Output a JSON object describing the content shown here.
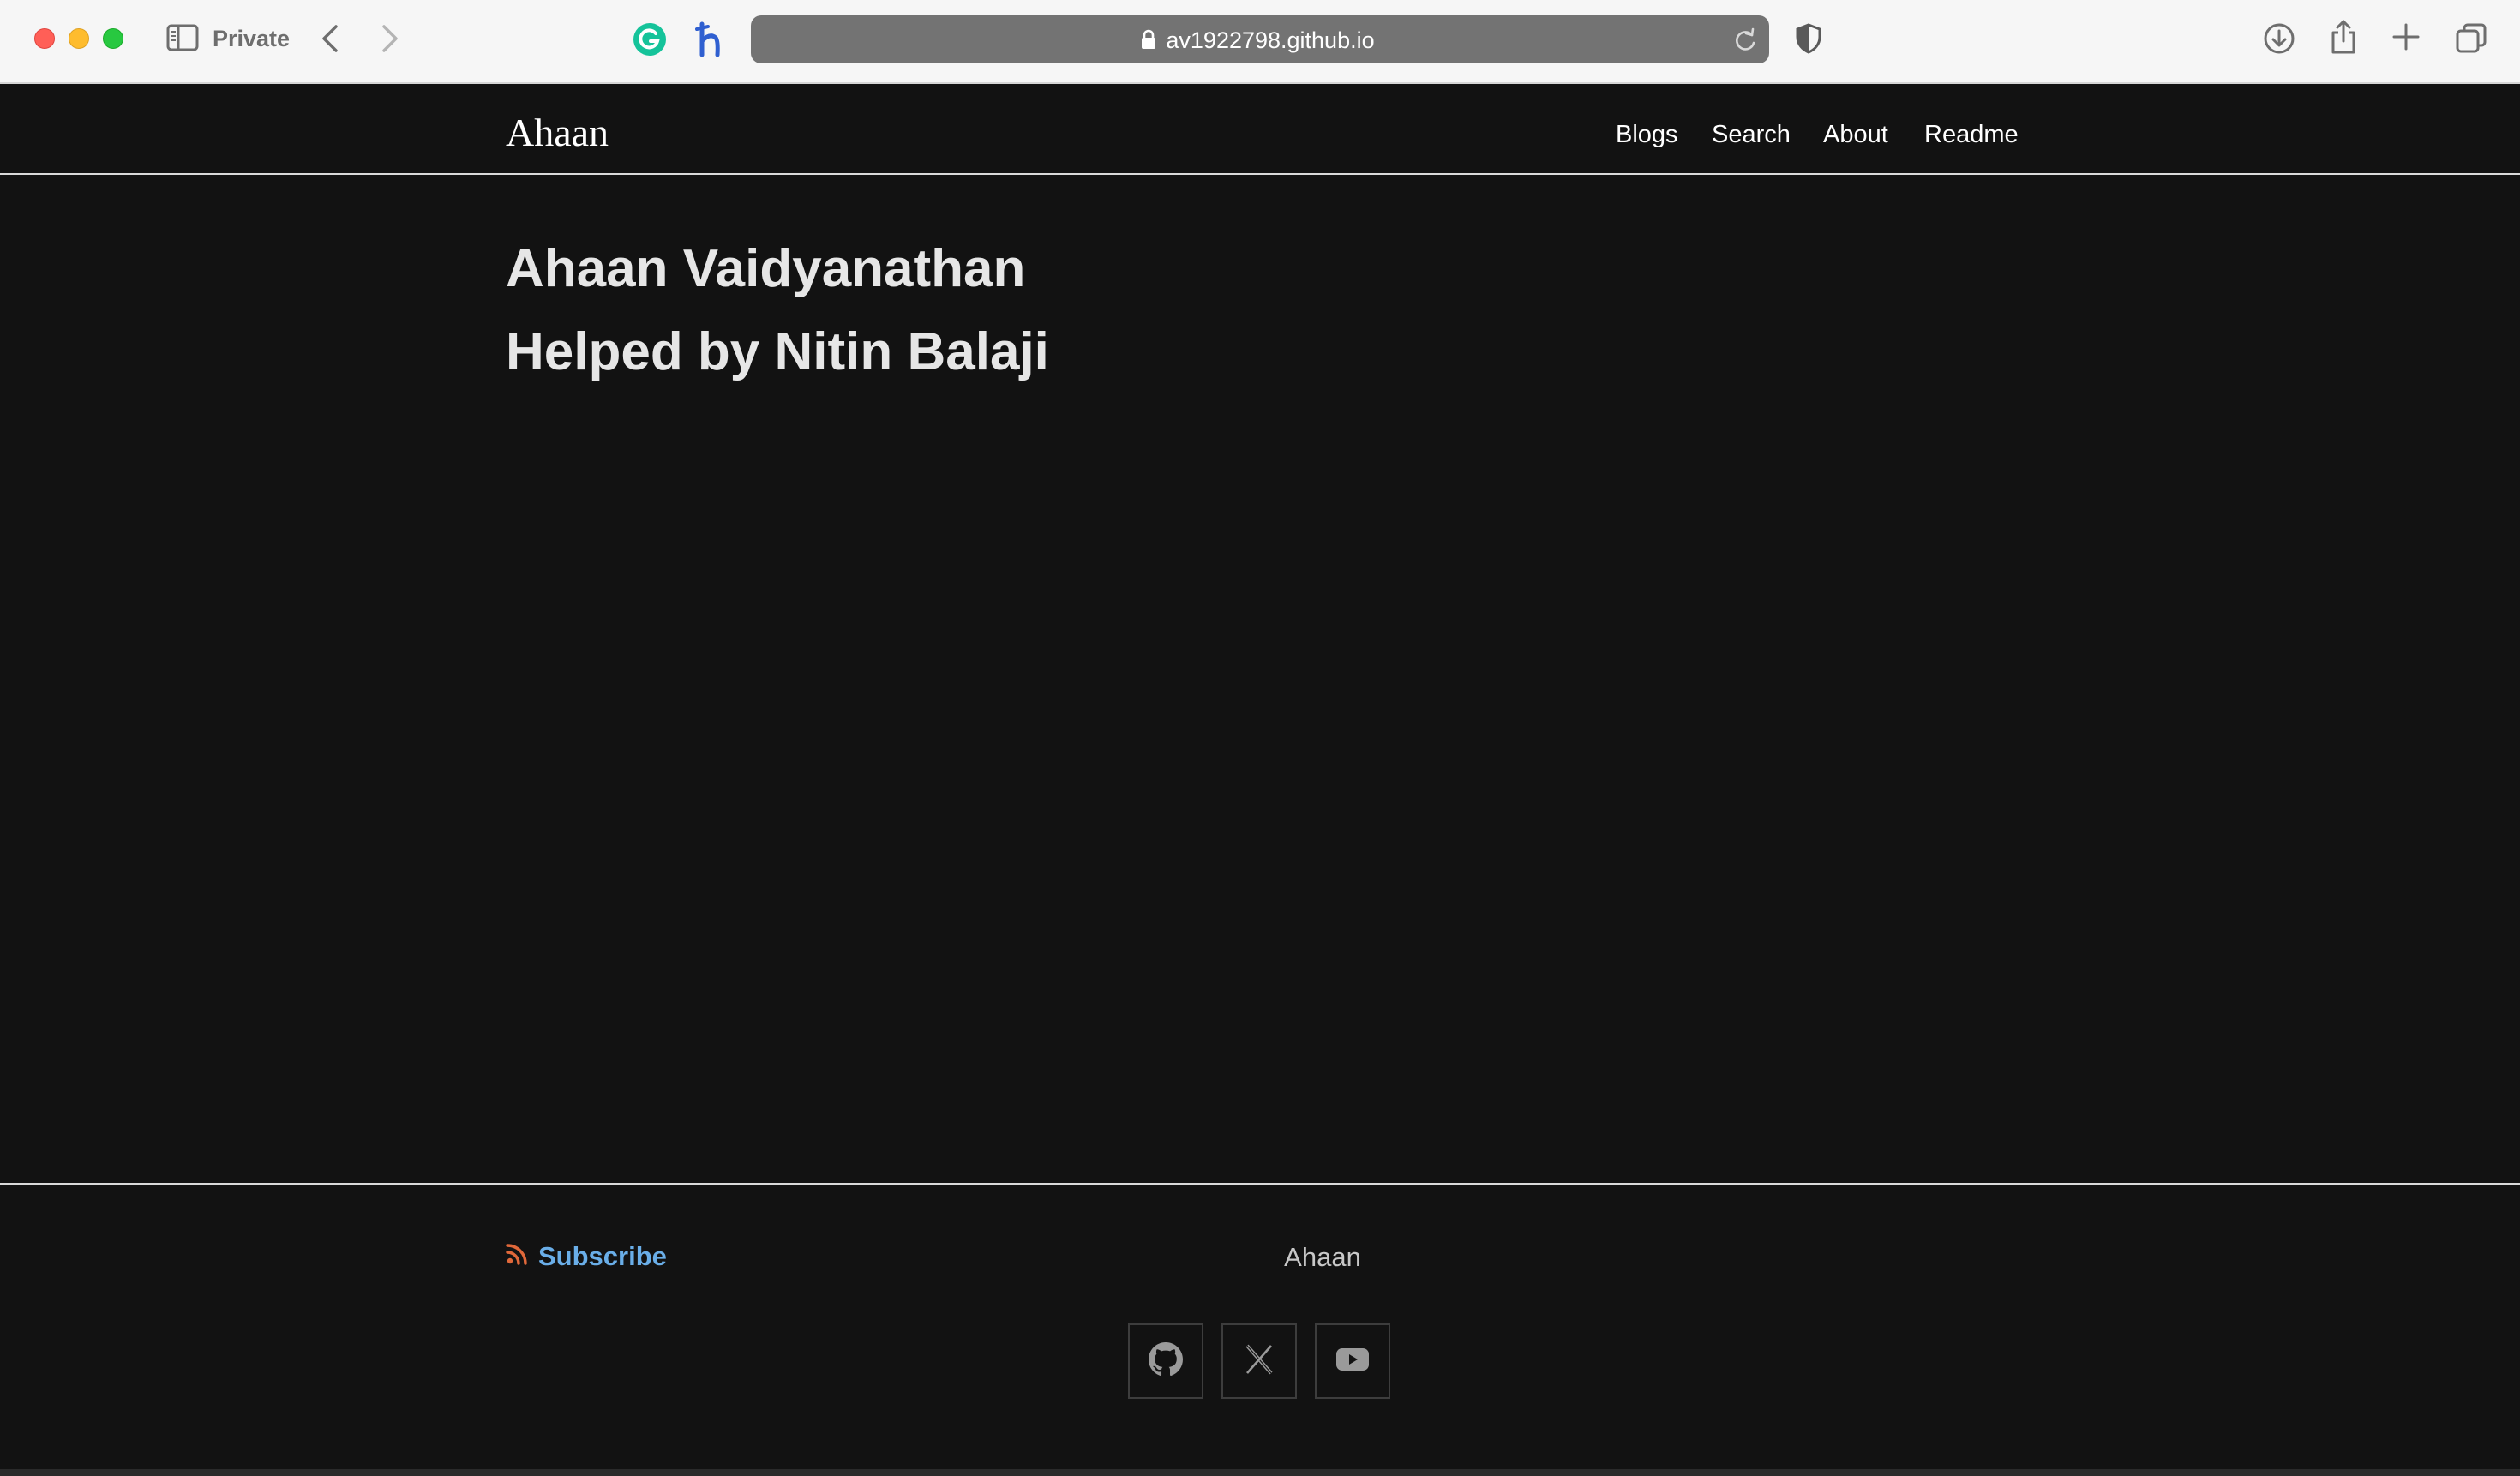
{
  "browser": {
    "mode_label": "Private",
    "url": "av1922798.github.io",
    "icons": [
      "sidebar-icon",
      "back-icon",
      "forward-icon",
      "grammarly-icon",
      "honey-icon",
      "lock-icon",
      "reload-icon",
      "shield-icon",
      "download-icon",
      "share-icon",
      "new-tab-icon",
      "tab-overview-icon"
    ]
  },
  "site": {
    "logo": "Ahaan",
    "nav": [
      "Blogs",
      "Search",
      "About",
      "Readme"
    ]
  },
  "main": {
    "lines": [
      "Ahaan Vaidyanathan",
      "Helped by Nitin Balaji"
    ]
  },
  "footer": {
    "subscribe_label": "Subscribe",
    "name": "Ahaan",
    "social": [
      "github-icon",
      "x-icon",
      "youtube-icon"
    ]
  },
  "colors": {
    "page_bg": "#121212",
    "subscribe": "#6aaee8",
    "rss": "#e0683a"
  }
}
